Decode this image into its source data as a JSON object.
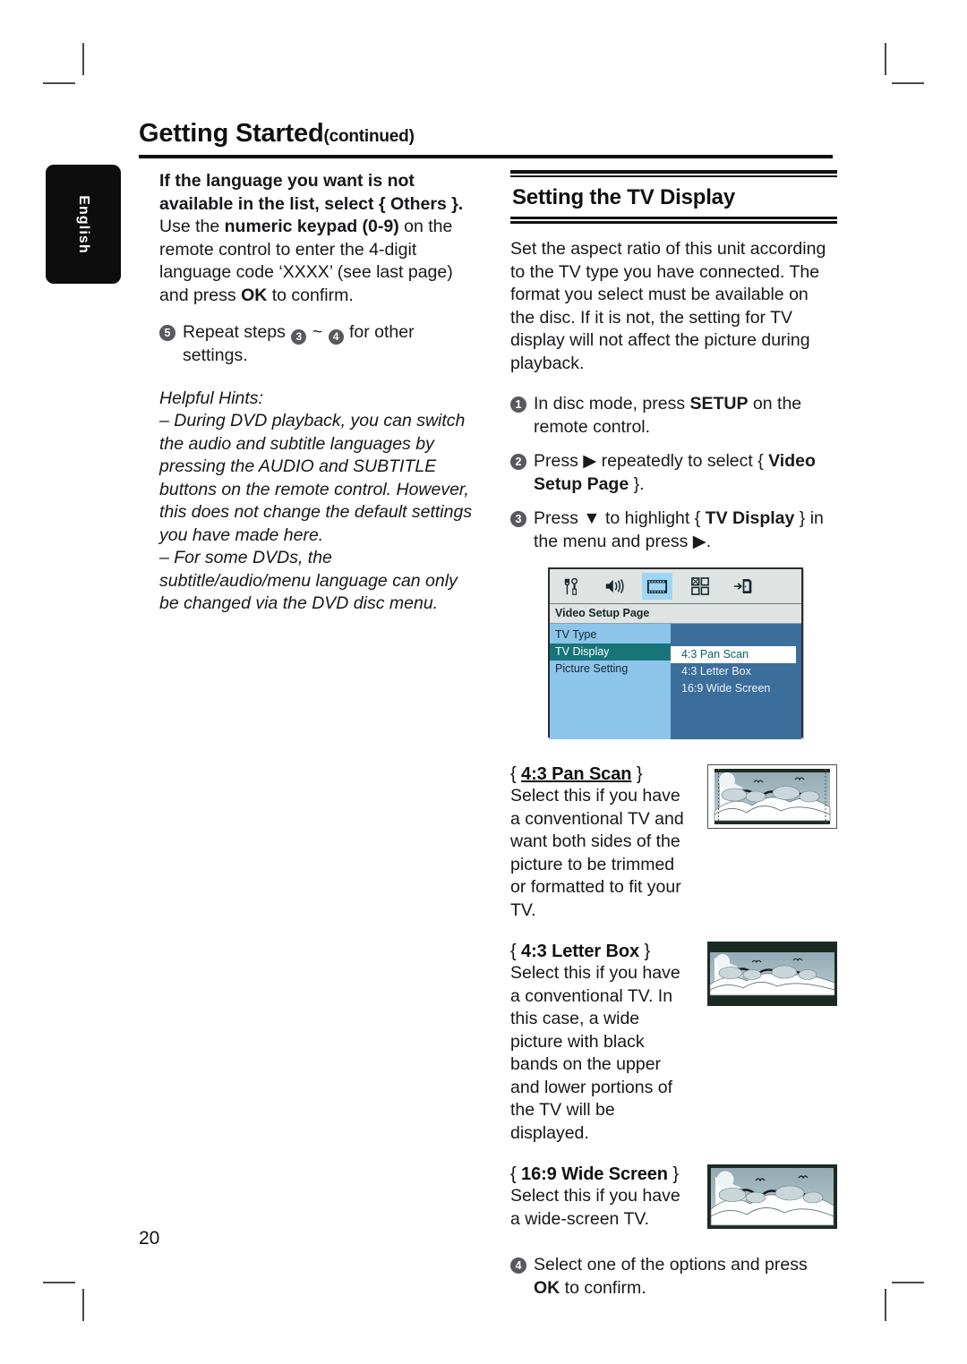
{
  "header": {
    "title": "Getting Started",
    "continued": "(continued)"
  },
  "side_tab": {
    "label": "English"
  },
  "page_number": "20",
  "left_column": {
    "intro_bold_lines": [
      "If the language you want is not",
      "available in the list, select { Others }."
    ],
    "intro_rest_prefix": "Use the ",
    "intro_rest_bold": "numeric keypad (0-9)",
    "intro_rest_mid": " on the remote control to enter the 4-digit language code ‘XXXX’ (see last page) and press ",
    "intro_rest_bold2": "OK",
    "intro_rest_end": " to confirm.",
    "step5": {
      "number": "5",
      "text_a": "Repeat steps ",
      "ref_a": "3",
      "text_b": " ~ ",
      "ref_b": "4",
      "text_c": " for other settings."
    },
    "hints_title": "Helpful Hints:",
    "hints": [
      "– During DVD playback, you can switch the audio and subtitle languages by pressing the AUDIO and SUBTITLE buttons on the remote control. However, this does not change the default settings you have made here.",
      "– For some DVDs, the subtitle/audio/menu language can only be changed via the DVD disc menu."
    ]
  },
  "right_column": {
    "section_heading": "Setting the TV Display",
    "section_body": "Set the aspect ratio of this unit according to the TV type you have connected. The format you select must be available on the disc. If it is not, the setting for TV display will not affect the picture during playback.",
    "steps": [
      {
        "number": "1",
        "pre": "In disc mode, press ",
        "bold": "SETUP",
        "post": " on the remote control."
      },
      {
        "number": "2",
        "pre": "Press ",
        "arrow": "▶",
        "mid": " repeatedly to select { ",
        "bold": "Video Setup Page",
        "post": " }."
      },
      {
        "number": "3",
        "pre": "Press ",
        "arrow": "▼",
        "mid": " to highlight { ",
        "bold": "TV Display",
        "post": " } in the menu and press ",
        "arrow2": "▶",
        "end": "."
      },
      {
        "number": "4",
        "pre": "Select one of the options and press ",
        "bold": "OK",
        "post": " to confirm."
      }
    ],
    "osd": {
      "icons": [
        "tools-icon",
        "speaker-icon",
        "film-strip-icon",
        "grid-squares-icon",
        "exit-door-icon"
      ],
      "selected_icon_index": 2,
      "page_title": "Video Setup Page",
      "menu_items": [
        "TV Type",
        "TV Display",
        "Picture Setting"
      ],
      "highlighted_item": "TV Display",
      "options": [
        "4:3 Pan Scan",
        "4:3 Letter Box",
        "16:9 Wide Screen"
      ],
      "highlighted_option": "4:3 Pan Scan",
      "colors": {
        "iconbar_bg": "#dfe4e2",
        "left_panel": "#8cc4ea",
        "right_panel": "#3c6e9c",
        "item_highlight": "#17757a",
        "option_highlight_bg": "#ffffff",
        "option_highlight_text": "#0f5b62",
        "icon_selected_bg": "#9fd6f5"
      }
    },
    "aspect_blocks": [
      {
        "brace_open": "{ ",
        "name": "4:3 Pan Scan",
        "brace_close": " }",
        "underlined": true,
        "text": "Select this if you have a conventional TV and want both sides of the picture to be trimmed or formatted to fit your TV.",
        "image": "tv-pan-scan-preview"
      },
      {
        "brace_open": "{ ",
        "name": "4:3 Letter Box",
        "brace_close": " }",
        "underlined": false,
        "text": "Select this if you have a conventional TV. In this case, a wide picture with black bands on the upper and lower portions of the TV will be displayed.",
        "image": "tv-letter-box-preview"
      },
      {
        "brace_open": "{ ",
        "name": "16:9 Wide Screen",
        "brace_close": " }",
        "underlined": false,
        "text": "Select this if you have a wide-screen TV.",
        "image": "tv-wide-screen-preview"
      }
    ]
  }
}
